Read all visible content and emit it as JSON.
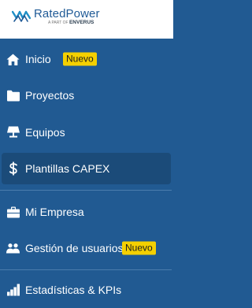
{
  "brand": {
    "name": "RatedPower",
    "sub_prefix": "A PART OF",
    "sub_company": "ENVERUS",
    "color": "#1f5a96"
  },
  "sidebar": {
    "background": "#215a92",
    "active_background": "#1b4b79",
    "badge_color": "#f5d000",
    "items": [
      {
        "label": "Inicio",
        "icon": "home-icon",
        "badge": "Nuevo"
      },
      {
        "label": "Proyectos",
        "icon": "folder-icon"
      },
      {
        "label": "Equipos",
        "icon": "solar-panel-icon"
      },
      {
        "label": "Plantillas CAPEX",
        "icon": "dollar-icon",
        "active": true
      },
      {
        "label": "Mi Empresa",
        "icon": "briefcase-icon"
      },
      {
        "label": "Gestión de usuarios",
        "icon": "users-icon",
        "badge": "Nuevo"
      },
      {
        "label": "Estadísticas & KPIs",
        "icon": "bar-chart-icon"
      }
    ]
  }
}
